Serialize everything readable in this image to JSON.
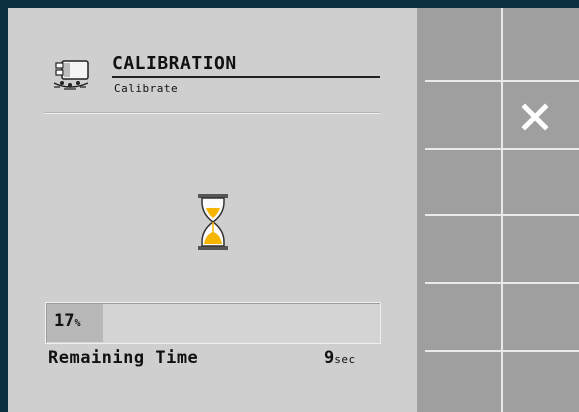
{
  "header": {
    "title": "CALIBRATION",
    "subtitle": "Calibrate",
    "icon": "calibration-machine-icon"
  },
  "status": {
    "icon": "hourglass-icon",
    "accent_color": "#f5b400"
  },
  "progress": {
    "percent": 17,
    "value_label": "17",
    "unit_label": "%"
  },
  "remaining": {
    "label": "Remaining Time",
    "value": "9",
    "unit": "sec"
  },
  "softkeys": [
    {
      "icon": ""
    },
    {
      "icon": "close-icon"
    },
    {
      "icon": ""
    },
    {
      "icon": ""
    },
    {
      "icon": ""
    },
    {
      "icon": ""
    }
  ]
}
